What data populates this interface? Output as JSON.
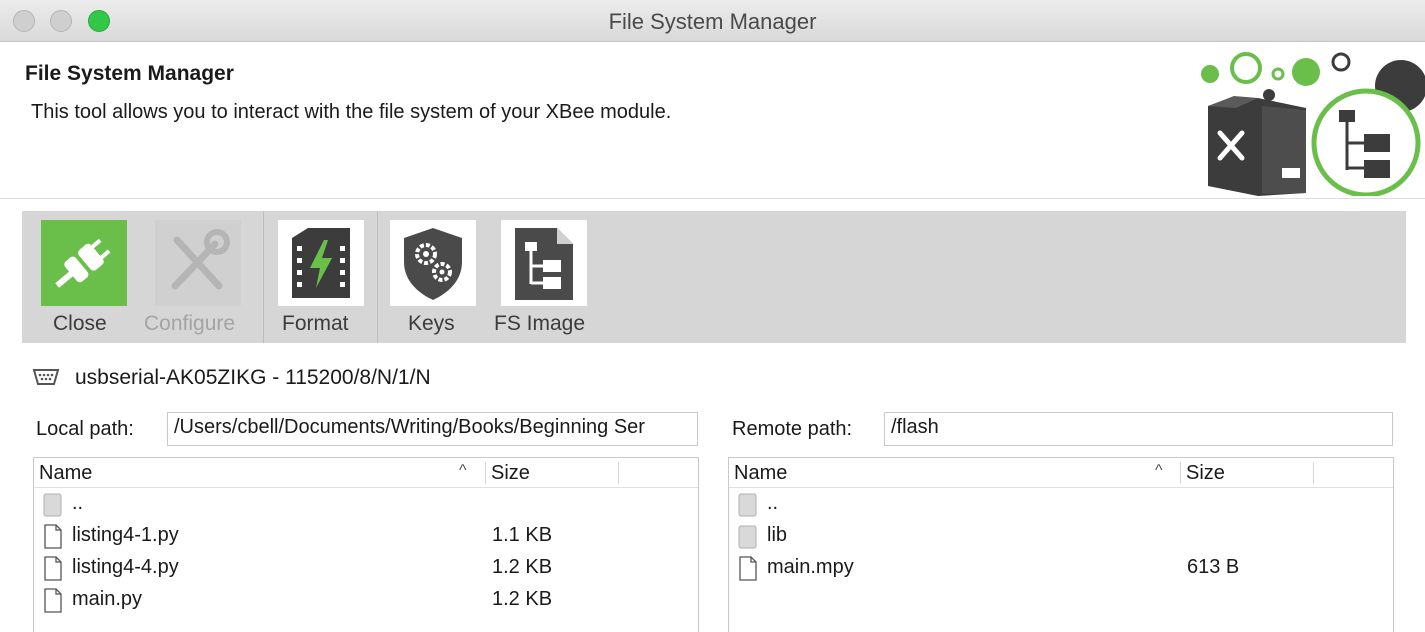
{
  "window": {
    "title": "File System Manager"
  },
  "header": {
    "title": "File System Manager",
    "description": "This tool allows you to interact with the file system of your XBee module.",
    "accent_color": "#6abf4b"
  },
  "toolbar": {
    "items": [
      {
        "label": "Close",
        "icon": "plug-disconnect-icon",
        "enabled": true,
        "active": true
      },
      {
        "label": "Configure",
        "icon": "wrench-screwdriver-icon",
        "enabled": false
      },
      {
        "label": "Format",
        "icon": "memory-chip-lightning-icon",
        "enabled": true
      },
      {
        "label": "Keys",
        "icon": "shield-gears-icon",
        "enabled": true
      },
      {
        "label": "FS Image",
        "icon": "folder-tree-document-icon",
        "enabled": true
      }
    ]
  },
  "connection": {
    "icon": "serial-port-icon",
    "text": "usbserial-AK05ZIKG - 115200/8/N/1/N"
  },
  "local": {
    "path_label": "Local path:",
    "path_value": "/Users/cbell/Documents/Writing/Books/Beginning Ser",
    "columns": {
      "name": "Name",
      "size": "Size"
    },
    "rows": [
      {
        "name": "..",
        "size": "",
        "type": "folder"
      },
      {
        "name": "listing4-1.py",
        "size": "1.1 KB",
        "type": "file"
      },
      {
        "name": "listing4-4.py",
        "size": "1.2 KB",
        "type": "file"
      },
      {
        "name": "main.py",
        "size": "1.2 KB",
        "type": "file"
      }
    ]
  },
  "remote": {
    "path_label": "Remote path:",
    "path_value": "/flash",
    "columns": {
      "name": "Name",
      "size": "Size"
    },
    "rows": [
      {
        "name": "..",
        "size": "",
        "type": "folder"
      },
      {
        "name": "lib",
        "size": "",
        "type": "folder"
      },
      {
        "name": "main.mpy",
        "size": "613 B",
        "type": "file"
      }
    ]
  }
}
